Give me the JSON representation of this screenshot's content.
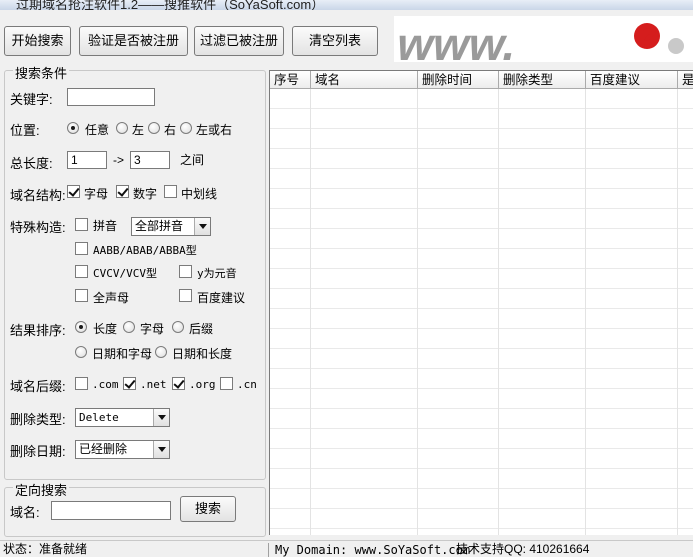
{
  "window": {
    "title": "过期域名抢注软件1.2——搜推软件（SoYaSoft.com）"
  },
  "toolbar": {
    "start_search": "开始搜索",
    "verify_registered": "验证是否被注册",
    "filter_registered": "过滤已被注册",
    "clear_list": "清空列表"
  },
  "banner": {
    "text": "www.",
    "text2": "?"
  },
  "search_conditions": {
    "title": "搜索条件",
    "keyword": {
      "label": "关键字:",
      "value": ""
    },
    "position": {
      "label": "位置:",
      "options": [
        "任意",
        "左",
        "右",
        "左或右"
      ],
      "selected": "任意"
    },
    "length": {
      "label": "总长度:",
      "min": "1",
      "arrow": "->",
      "max": "3",
      "suffix": "之间"
    },
    "structure": {
      "label": "域名结构:",
      "options": [
        {
          "label": "字母",
          "checked": true
        },
        {
          "label": "数字",
          "checked": true
        },
        {
          "label": "中划线",
          "checked": false
        }
      ]
    },
    "special": {
      "label": "特殊构造:",
      "pinyin": {
        "label": "拼音",
        "checked": false
      },
      "pinyin_mode": "全部拼音",
      "aabb": {
        "label": "AABB/ABAB/ABBA型",
        "checked": false
      },
      "cvcv": {
        "label": "CVCV/VCV型",
        "checked": false
      },
      "y_vowel": {
        "label": "y为元音",
        "checked": false
      },
      "all_initials": {
        "label": "全声母",
        "checked": false
      },
      "baidu": {
        "label": "百度建议",
        "checked": false
      }
    },
    "sort": {
      "label": "结果排序:",
      "options": [
        "长度",
        "字母",
        "后缀",
        "日期和字母",
        "日期和长度"
      ],
      "selected": "长度"
    },
    "suffix": {
      "label": "域名后缀:",
      "options": [
        {
          "label": ".com",
          "checked": false
        },
        {
          "label": ".net",
          "checked": true
        },
        {
          "label": ".org",
          "checked": true
        },
        {
          "label": ".cn",
          "checked": false
        }
      ]
    },
    "delete_type": {
      "label": "删除类型:",
      "value": "Delete"
    },
    "delete_date": {
      "label": "删除日期:",
      "value": "已经删除"
    }
  },
  "targeted_search": {
    "title": "定向搜索",
    "domain_label": "域名:",
    "domain_value": "",
    "search_button": "搜索"
  },
  "grid": {
    "columns": [
      "序号",
      "域名",
      "删除时间",
      "删除类型",
      "百度建议",
      "是"
    ],
    "rows": []
  },
  "status": {
    "state": "状态：准备就绪",
    "domain": "My Domain: www.SoYaSoft.com",
    "support": "技术支持QQ: 410261664"
  }
}
